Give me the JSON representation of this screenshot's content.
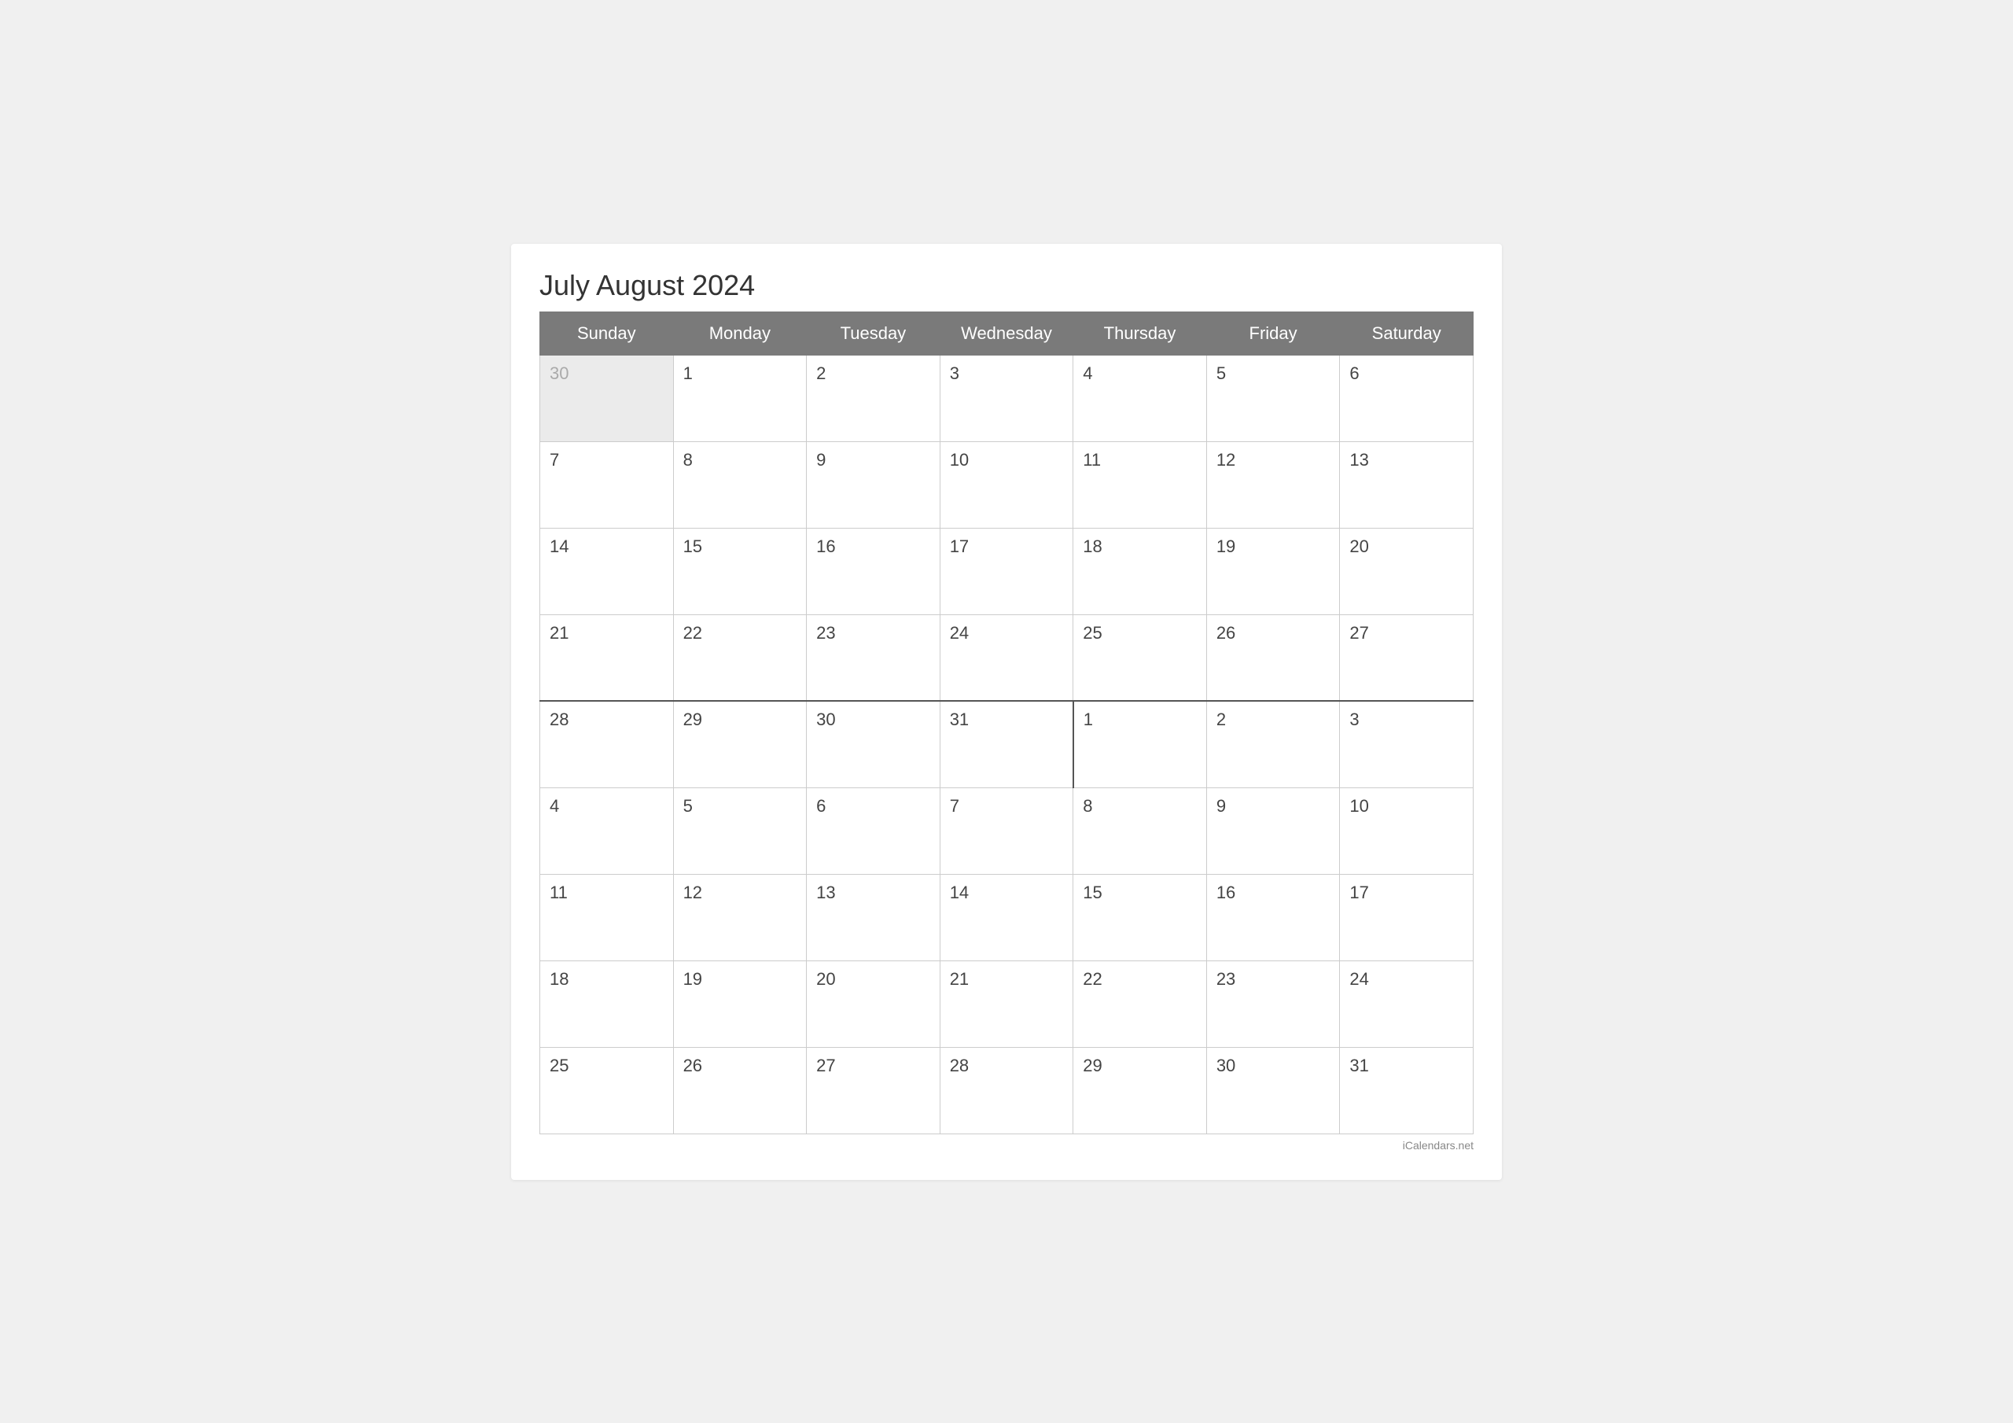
{
  "title": "July August 2024",
  "watermark": "iCalendars.net",
  "headers": [
    "Sunday",
    "Monday",
    "Tuesday",
    "Wednesday",
    "Thursday",
    "Friday",
    "Saturday"
  ],
  "weeks": [
    {
      "id": "week1",
      "cells": [
        {
          "day": "30",
          "type": "prev-month"
        },
        {
          "day": "1",
          "type": "current"
        },
        {
          "day": "2",
          "type": "current"
        },
        {
          "day": "3",
          "type": "current"
        },
        {
          "day": "4",
          "type": "current"
        },
        {
          "day": "5",
          "type": "current"
        },
        {
          "day": "6",
          "type": "current"
        }
      ]
    },
    {
      "id": "week2",
      "cells": [
        {
          "day": "7",
          "type": "current"
        },
        {
          "day": "8",
          "type": "current"
        },
        {
          "day": "9",
          "type": "current"
        },
        {
          "day": "10",
          "type": "current"
        },
        {
          "day": "11",
          "type": "current"
        },
        {
          "day": "12",
          "type": "current"
        },
        {
          "day": "13",
          "type": "current"
        }
      ]
    },
    {
      "id": "week3",
      "cells": [
        {
          "day": "14",
          "type": "current"
        },
        {
          "day": "15",
          "type": "current"
        },
        {
          "day": "16",
          "type": "current"
        },
        {
          "day": "17",
          "type": "current"
        },
        {
          "day": "18",
          "type": "current"
        },
        {
          "day": "19",
          "type": "current"
        },
        {
          "day": "20",
          "type": "current"
        }
      ]
    },
    {
      "id": "week4",
      "cells": [
        {
          "day": "21",
          "type": "current"
        },
        {
          "day": "22",
          "type": "current"
        },
        {
          "day": "23",
          "type": "current"
        },
        {
          "day": "24",
          "type": "current"
        },
        {
          "day": "25",
          "type": "current"
        },
        {
          "day": "26",
          "type": "current"
        },
        {
          "day": "27",
          "type": "current"
        }
      ]
    },
    {
      "id": "week5-divider",
      "divider": true,
      "cells": [
        {
          "day": "28",
          "type": "current"
        },
        {
          "day": "29",
          "type": "current"
        },
        {
          "day": "30",
          "type": "current"
        },
        {
          "day": "31",
          "type": "current"
        },
        {
          "day": "1",
          "type": "next-month",
          "divider-cell": true
        },
        {
          "day": "2",
          "type": "next-month"
        },
        {
          "day": "3",
          "type": "next-month"
        }
      ]
    },
    {
      "id": "week6",
      "cells": [
        {
          "day": "4",
          "type": "next-month"
        },
        {
          "day": "5",
          "type": "next-month"
        },
        {
          "day": "6",
          "type": "next-month"
        },
        {
          "day": "7",
          "type": "next-month"
        },
        {
          "day": "8",
          "type": "next-month"
        },
        {
          "day": "9",
          "type": "next-month"
        },
        {
          "day": "10",
          "type": "next-month"
        }
      ]
    },
    {
      "id": "week7",
      "cells": [
        {
          "day": "11",
          "type": "next-month"
        },
        {
          "day": "12",
          "type": "next-month"
        },
        {
          "day": "13",
          "type": "next-month"
        },
        {
          "day": "14",
          "type": "next-month"
        },
        {
          "day": "15",
          "type": "next-month"
        },
        {
          "day": "16",
          "type": "next-month"
        },
        {
          "day": "17",
          "type": "next-month"
        }
      ]
    },
    {
      "id": "week8",
      "cells": [
        {
          "day": "18",
          "type": "next-month"
        },
        {
          "day": "19",
          "type": "next-month"
        },
        {
          "day": "20",
          "type": "next-month"
        },
        {
          "day": "21",
          "type": "next-month"
        },
        {
          "day": "22",
          "type": "next-month"
        },
        {
          "day": "23",
          "type": "next-month"
        },
        {
          "day": "24",
          "type": "next-month"
        }
      ]
    },
    {
      "id": "week9",
      "cells": [
        {
          "day": "25",
          "type": "next-month"
        },
        {
          "day": "26",
          "type": "next-month"
        },
        {
          "day": "27",
          "type": "next-month"
        },
        {
          "day": "28",
          "type": "next-month"
        },
        {
          "day": "29",
          "type": "next-month"
        },
        {
          "day": "30",
          "type": "next-month"
        },
        {
          "day": "31",
          "type": "next-month"
        }
      ]
    }
  ]
}
